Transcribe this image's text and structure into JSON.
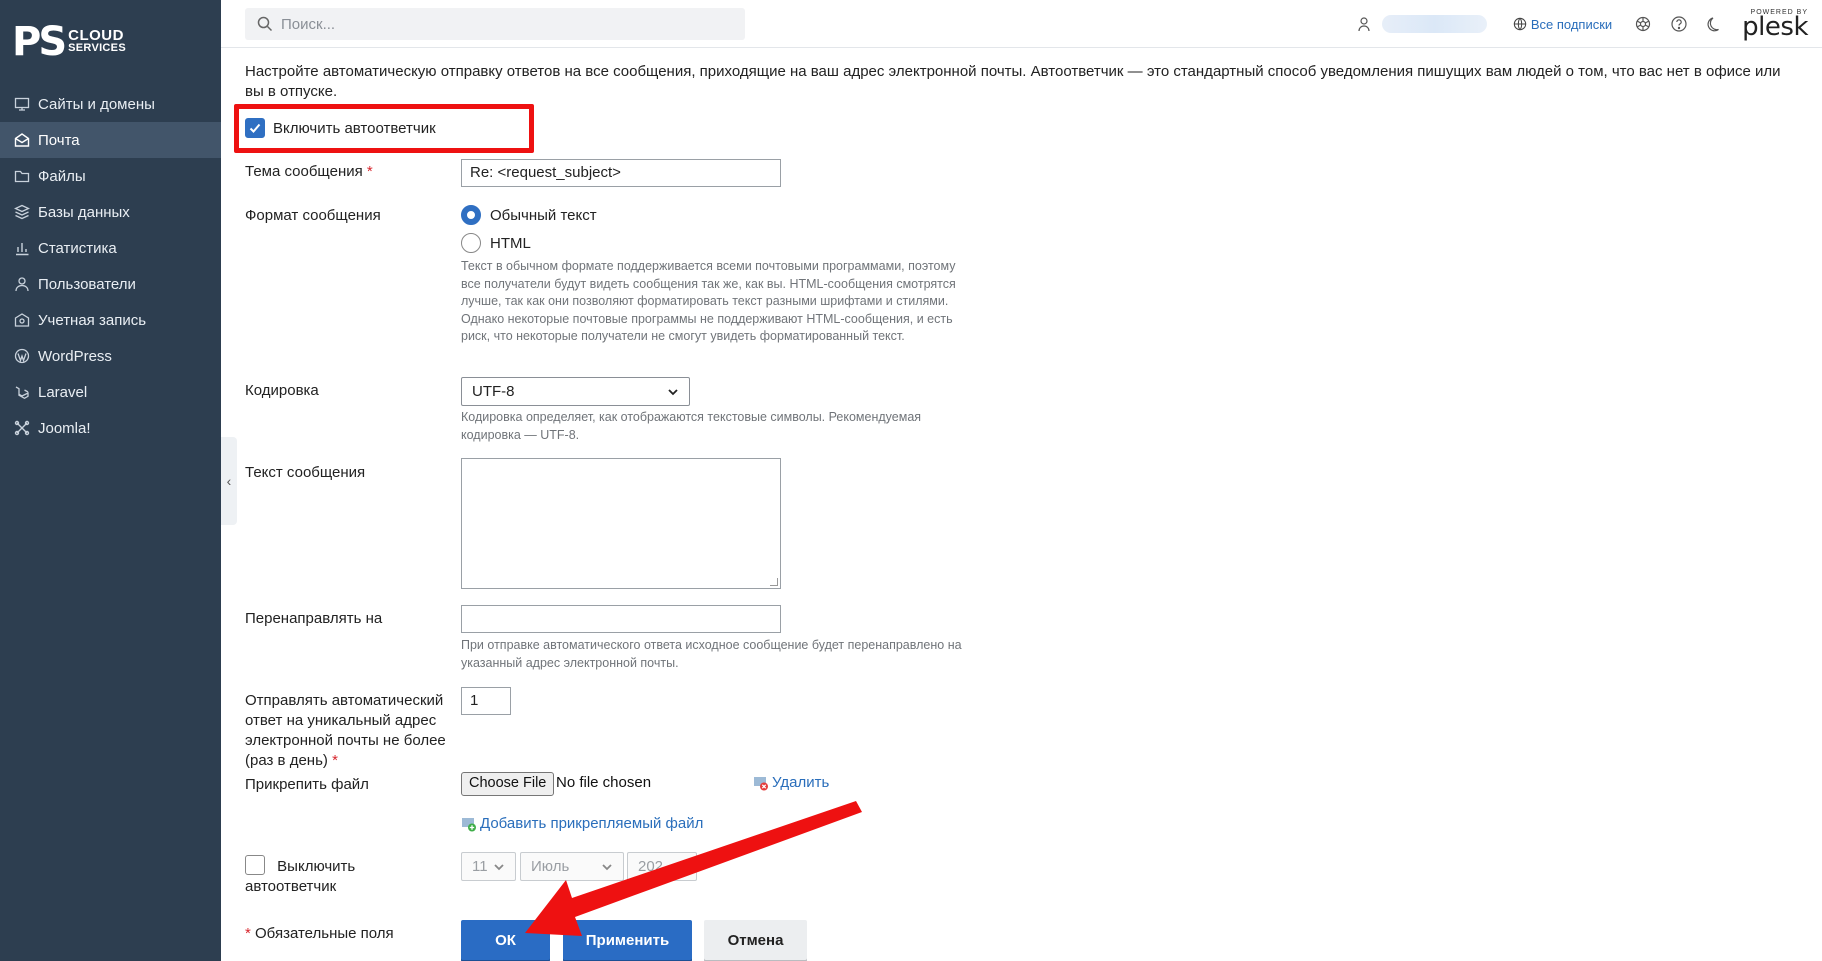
{
  "brand": {
    "mark": "PS",
    "line1": "CLOUD",
    "line2": "SERVICES"
  },
  "sidebar": {
    "items": [
      {
        "label": "Сайты и домены",
        "icon": "monitor-icon"
      },
      {
        "label": "Почта",
        "icon": "mail-icon",
        "active": true
      },
      {
        "label": "Файлы",
        "icon": "folder-icon"
      },
      {
        "label": "Базы данных",
        "icon": "database-icon"
      },
      {
        "label": "Статистика",
        "icon": "chart-icon"
      },
      {
        "label": "Пользователи",
        "icon": "user-icon"
      },
      {
        "label": "Учетная запись",
        "icon": "account-icon"
      },
      {
        "label": "WordPress",
        "icon": "wordpress-icon"
      },
      {
        "label": "Laravel",
        "icon": "laravel-icon"
      },
      {
        "label": "Joomla!",
        "icon": "joomla-icon"
      }
    ]
  },
  "topbar": {
    "search_placeholder": "Поиск...",
    "subscriptions_label": "Все подписки",
    "powered_by": "POWERED BY",
    "plesk": "plesk"
  },
  "form": {
    "intro": "Настройте автоматическую отправку ответов на все сообщения, приходящие на ваш адрес электронной почты. Автоответчик — это стандартный способ уведомления пишущих вам людей о том, что вас нет в офисе или вы в отпуске.",
    "enable_label": "Включить автоответчик",
    "subject_label": "Тема сообщения",
    "subject_value": "Re: <request_subject>",
    "required_mark": "*",
    "format_label": "Формат сообщения",
    "format_plain": "Обычный текст",
    "format_html": "HTML",
    "format_hint": "Текст в обычном формате поддерживается всеми почтовыми программами, поэтому все получатели будут видеть сообщения так же, как вы. HTML-сообщения смотрятся лучше, так как они позволяют форматировать текст разными шрифтами и стилями. Однако некоторые почтовые программы не поддерживают HTML-сообщения, и есть риск, что некоторые получатели не смогут увидеть форматированный текст.",
    "encoding_label": "Кодировка",
    "encoding_value": "UTF-8",
    "encoding_hint": "Кодировка определяет, как отображаются текстовые символы. Рекомендуемая кодировка — UTF-8.",
    "message_label": "Текст сообщения",
    "message_value": "",
    "forward_label": "Перенаправлять на",
    "forward_value": "",
    "forward_hint": "При отправке автоматического ответа исходное сообщение будет перенаправлено на указанный адрес электронной почты.",
    "frequency_label": "Отправлять автоматический ответ на уникальный адрес электронной почты не более (раз в день)",
    "frequency_value": "1",
    "attach_label": "Прикрепить файл",
    "choose_file": "Choose File",
    "no_file": "No file chosen",
    "delete_label": "Удалить",
    "add_attachment": "Добавить прикрепляемый файл",
    "disable_label": "Выключить автоответчик",
    "day_value": "11",
    "month_value": "Июль",
    "year_value": "202",
    "required_note": "Обязательные поля",
    "ok": "ОК",
    "apply": "Применить",
    "cancel": "Отмена"
  },
  "colors": {
    "sidebar_bg": "#2d3e50",
    "sidebar_active": "#42556a",
    "accent": "#2a6cc4",
    "link": "#2a6ebb",
    "annotation": "#ee1111"
  }
}
